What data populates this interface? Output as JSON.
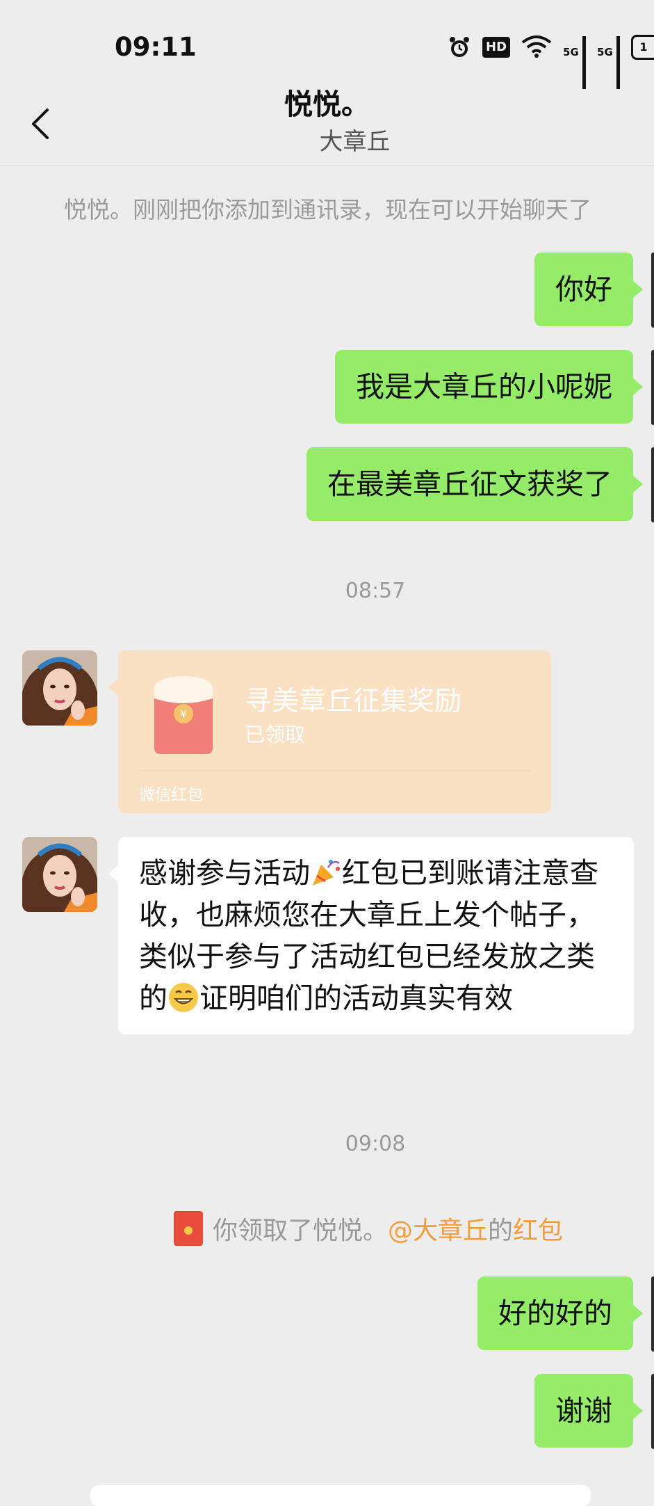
{
  "status_bar": {
    "time": "09:11",
    "hd_label": "HD",
    "net_label_1": "5G",
    "net_label_2": "5G",
    "battery_label": "1"
  },
  "header": {
    "title": "悦悦。",
    "subtitle": "大章丘"
  },
  "system_note": "悦悦。刚刚把你添加到通讯录，现在可以开始聊天了",
  "messages_top": [
    {
      "text": "你好"
    },
    {
      "text": "我是大章丘的小呢妮"
    },
    {
      "text": "在最美章丘征文获奖了"
    }
  ],
  "time_1": "08:57",
  "red_packet": {
    "title": "寻美章丘征集奖励",
    "status": "已领取",
    "footer": "微信红包",
    "symbol": "¥"
  },
  "long_message": {
    "part1": "感谢参与活动",
    "part2": "红包已到账请注意查收，也麻烦您在大章丘上发个帖子，类似于参与了活动红包已经发放之类的",
    "part3": "证明咱们的活动真实有效"
  },
  "time_2": "09:08",
  "received_note": {
    "prefix": "你领取了悦悦。",
    "mention": "@大章丘",
    "middle": "的",
    "link": "红包"
  },
  "messages_bottom": [
    {
      "text": "好的好的"
    },
    {
      "text": "谢谢"
    }
  ],
  "colors": {
    "bubble_mine": "#95ec69",
    "background": "#ededed",
    "red_packet_bg": "#fbe1c4",
    "highlight": "#f39c3a"
  }
}
